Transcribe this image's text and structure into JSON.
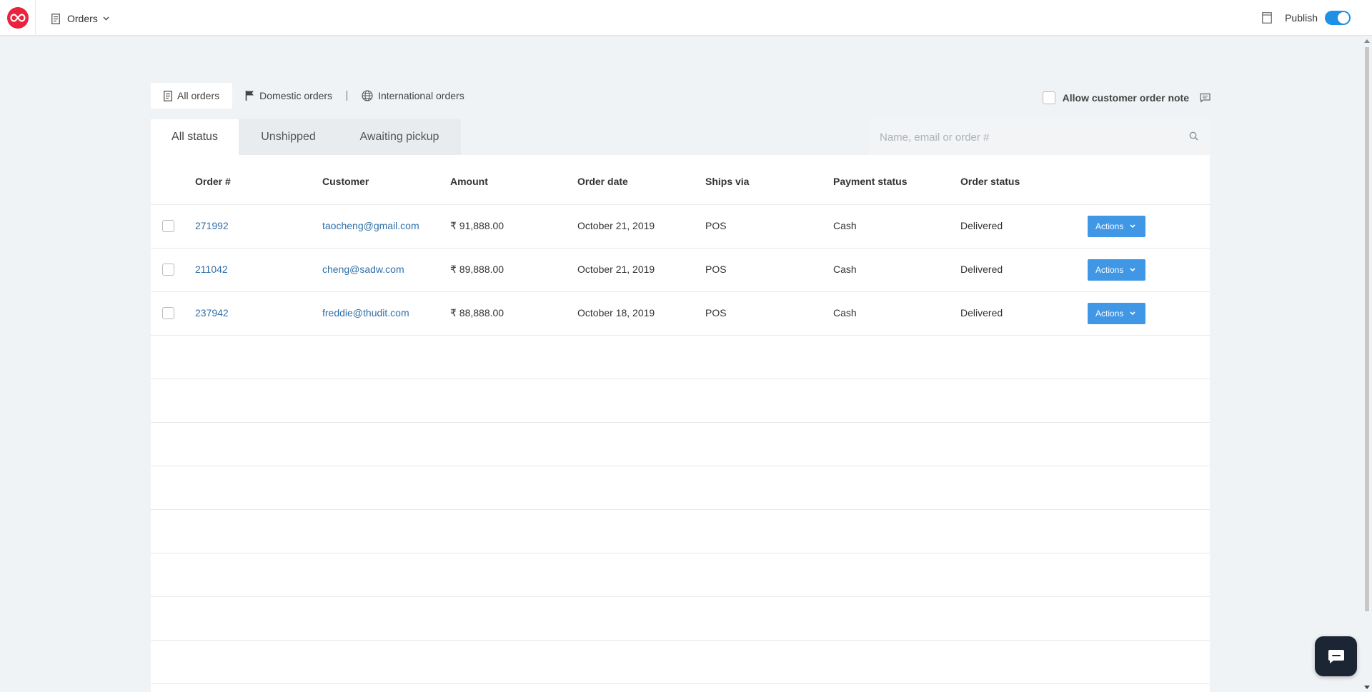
{
  "header": {
    "page_menu_label": "Orders",
    "publish_label": "Publish",
    "publish_enabled": true
  },
  "order_type_tabs": [
    {
      "label": "All orders",
      "icon": "document-icon",
      "active": true
    },
    {
      "label": "Domestic orders",
      "icon": "flag-icon",
      "active": false
    },
    {
      "label": "International orders",
      "icon": "globe-icon",
      "active": false
    }
  ],
  "order_note": {
    "label": "Allow customer order note",
    "checked": false
  },
  "status_tabs": [
    {
      "label": "All status",
      "active": true
    },
    {
      "label": "Unshipped",
      "active": false
    },
    {
      "label": "Awaiting pickup",
      "active": false
    }
  ],
  "search": {
    "placeholder": "Name, email or order #",
    "value": ""
  },
  "table": {
    "columns": [
      "Order #",
      "Customer",
      "Amount",
      "Order date",
      "Ships via",
      "Payment status",
      "Order status"
    ],
    "rows": [
      {
        "order": "271992",
        "customer": "taocheng@gmail.com",
        "amount": "₹ 91,888.00",
        "date": "October 21, 2019",
        "ships_via": "POS",
        "payment": "Cash",
        "status": "Delivered",
        "action": "Actions"
      },
      {
        "order": "211042",
        "customer": "cheng@sadw.com",
        "amount": "₹ 89,888.00",
        "date": "October 21, 2019",
        "ships_via": "POS",
        "payment": "Cash",
        "status": "Delivered",
        "action": "Actions"
      },
      {
        "order": "237942",
        "customer": "freddie@thudit.com",
        "amount": "₹ 88,888.00",
        "date": "October 18, 2019",
        "ships_via": "POS",
        "payment": "Cash",
        "status": "Delivered",
        "action": "Actions"
      }
    ]
  },
  "colors": {
    "brand": "#e8233e",
    "accent": "#3f97e6",
    "link": "#2f6fa8",
    "background": "#f0f3f5"
  }
}
